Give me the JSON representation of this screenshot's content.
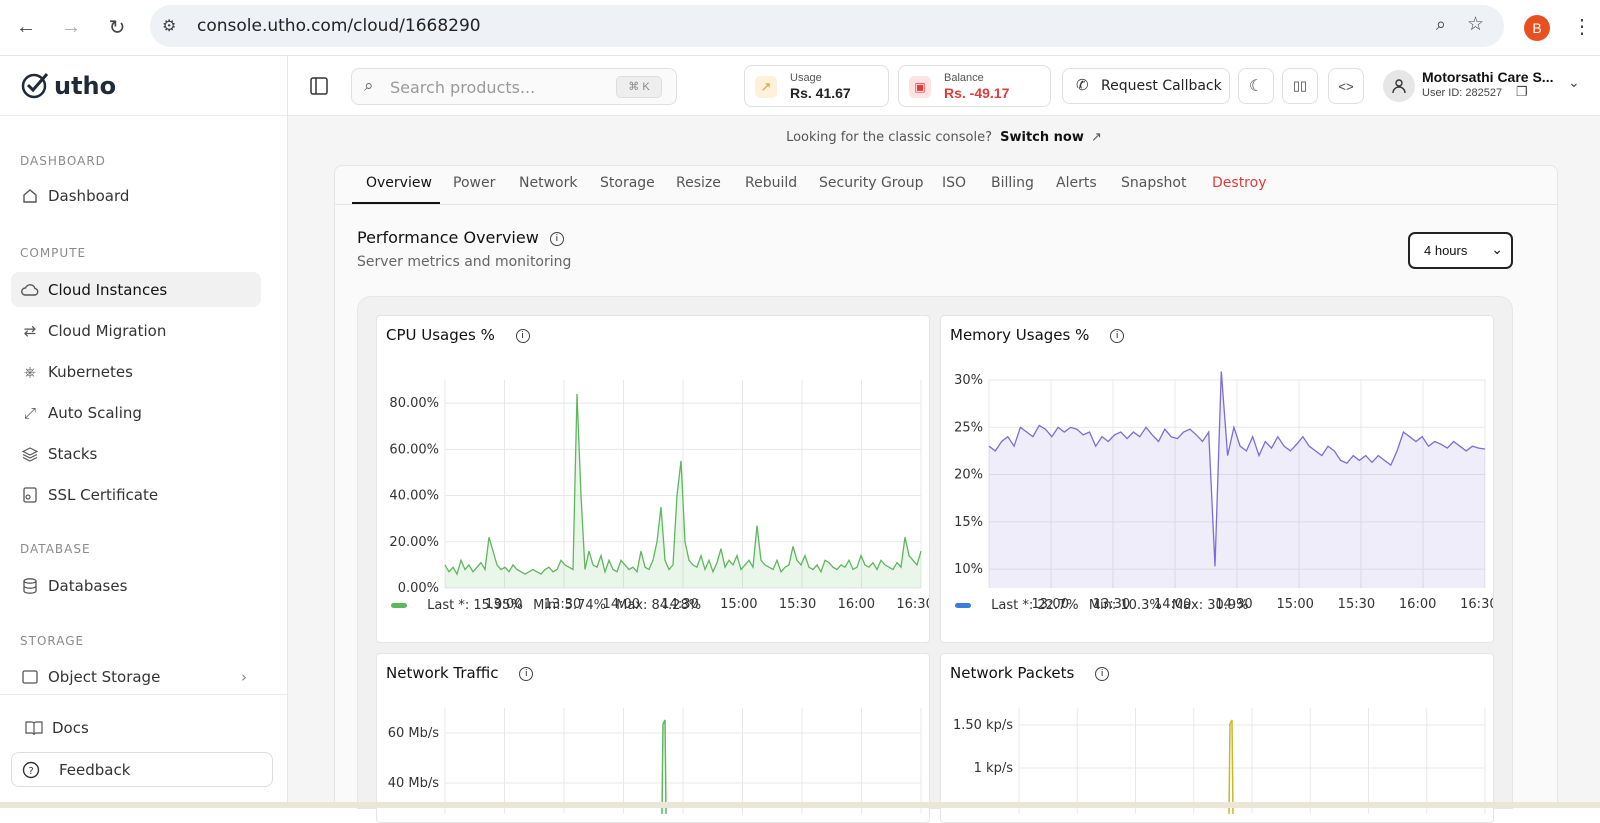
{
  "browser": {
    "url": "console.utho.com/cloud/1668290",
    "profile_initial": "B"
  },
  "sidebar": {
    "logo": "utho",
    "sections": [
      {
        "title": "DASHBOARD",
        "items": [
          {
            "label": "Dashboard",
            "icon": "home-icon"
          }
        ]
      },
      {
        "title": "COMPUTE",
        "items": [
          {
            "label": "Cloud Instances",
            "icon": "cloud-icon",
            "active": true
          },
          {
            "label": "Cloud Migration",
            "icon": "arrows-icon"
          },
          {
            "label": "Kubernetes",
            "icon": "kubernetes-icon"
          },
          {
            "label": "Auto Scaling",
            "icon": "scaling-icon"
          },
          {
            "label": "Stacks",
            "icon": "layers-icon"
          },
          {
            "label": "SSL Certificate",
            "icon": "certificate-icon"
          }
        ]
      },
      {
        "title": "DATABASE",
        "items": [
          {
            "label": "Databases",
            "icon": "database-icon"
          }
        ]
      },
      {
        "title": "STORAGE",
        "items": [
          {
            "label": "Object Storage",
            "icon": "bucket-icon"
          }
        ]
      }
    ],
    "footer": {
      "docs": "Docs",
      "feedback": "Feedback"
    }
  },
  "topbar": {
    "search_placeholder": "Search products...",
    "shortcut": "⌘ K",
    "usage_label": "Usage",
    "usage_value": "Rs. 41.67",
    "balance_label": "Balance",
    "balance_value": "Rs. -49.17",
    "callback": "Request Callback",
    "user_name": "Motorsathi Care S...",
    "user_id": "User ID: 282527"
  },
  "notice": {
    "text": "Looking for the classic console?",
    "link": "Switch now"
  },
  "tabs": [
    "Overview",
    "Power",
    "Network",
    "Storage",
    "Resize",
    "Rebuild",
    "Security Group",
    "ISO",
    "Billing",
    "Alerts",
    "Snapshot",
    "Destroy"
  ],
  "performance": {
    "title": "Performance Overview",
    "subtitle": "Server metrics and monitoring",
    "range": "4 hours"
  },
  "colors": {
    "cpu": "#5cb85c",
    "memory": "#7b6cd9",
    "packets": "#c9b82a",
    "danger": "#e23b3b"
  },
  "chart_data": [
    {
      "type": "area",
      "title": "CPU Usages %",
      "x_ticks": [
        "13:00",
        "13:30",
        "14:00",
        "14:30",
        "15:00",
        "15:30",
        "16:00",
        "16:30"
      ],
      "y_ticks": [
        "0.00%",
        "20.00%",
        "40.00%",
        "60.00%",
        "80.00%"
      ],
      "ylim": [
        0,
        90
      ],
      "series": [
        {
          "values": [
            10,
            7,
            9,
            6,
            12,
            8,
            10,
            7,
            9,
            11,
            8,
            22,
            16,
            10,
            8,
            9,
            7,
            10,
            8,
            7,
            6,
            7,
            8,
            7,
            6,
            8,
            9,
            7,
            8,
            12,
            10,
            9,
            8,
            84,
            40,
            8,
            16,
            10,
            9,
            14,
            7,
            12,
            8,
            7,
            12,
            10,
            8,
            9,
            7,
            16,
            9,
            8,
            12,
            20,
            35,
            12,
            8,
            10,
            40,
            55,
            20,
            12,
            10,
            9,
            14,
            8,
            12,
            7,
            11,
            17,
            9,
            12,
            10,
            14,
            8,
            10,
            12,
            9,
            27,
            12,
            10,
            9,
            8,
            12,
            7,
            9,
            10,
            18,
            12,
            10,
            14,
            9,
            8,
            10,
            7,
            12,
            11,
            9,
            8,
            10,
            9,
            12,
            8,
            9,
            14,
            10,
            9,
            11,
            8,
            12,
            10,
            9,
            8,
            11,
            9,
            22,
            14,
            12,
            10,
            16
          ]
        }
      ],
      "legend": {
        "last": "Last *: 15.95%",
        "min": "Min: 5.74%",
        "max": "Max: 84.28%"
      }
    },
    {
      "type": "area",
      "title": "Memory Usages %",
      "x_ticks": [
        "13:00",
        "13:30",
        "14:00",
        "14:30",
        "15:00",
        "15:30",
        "16:00",
        "16:30"
      ],
      "y_ticks": [
        "10%",
        "15%",
        "20%",
        "25%",
        "30%"
      ],
      "ylim": [
        8,
        30
      ],
      "series": [
        {
          "values": [
            23,
            22.5,
            23.5,
            24,
            23,
            25,
            24.5,
            24,
            25.2,
            24.8,
            24,
            25,
            24.5,
            25,
            24.8,
            24.2,
            24.5,
            23,
            24,
            23.5,
            24.2,
            24.5,
            23.8,
            24.5,
            24,
            25,
            24.2,
            23.5,
            24.8,
            24,
            23.8,
            24.5,
            24.8,
            24.2,
            23.5,
            24.5,
            10.3,
            30.9,
            22,
            25,
            23,
            22.5,
            24,
            22,
            23.5,
            22.8,
            24,
            23,
            22.5,
            23.2,
            24,
            23,
            22.5,
            22,
            23,
            22.5,
            21.5,
            21.2,
            22,
            21.5,
            22,
            21.3,
            22,
            21.5,
            21,
            22.5,
            24.5,
            24,
            23.5,
            24,
            23,
            23.5,
            23.2,
            22.8,
            23.5,
            23,
            22.5,
            23,
            22.8,
            22.7
          ]
        }
      ],
      "legend": {
        "last": "Last *: 22.7%",
        "min": "Min: 10.3%",
        "max": "Max: 30.9%"
      }
    },
    {
      "type": "line",
      "title": "Network Traffic",
      "y_ticks": [
        "60 Mb/s",
        "40 Mb/s"
      ]
    },
    {
      "type": "line",
      "title": "Network Packets",
      "y_ticks": [
        "1.50 kp/s",
        "1 kp/s"
      ]
    }
  ]
}
